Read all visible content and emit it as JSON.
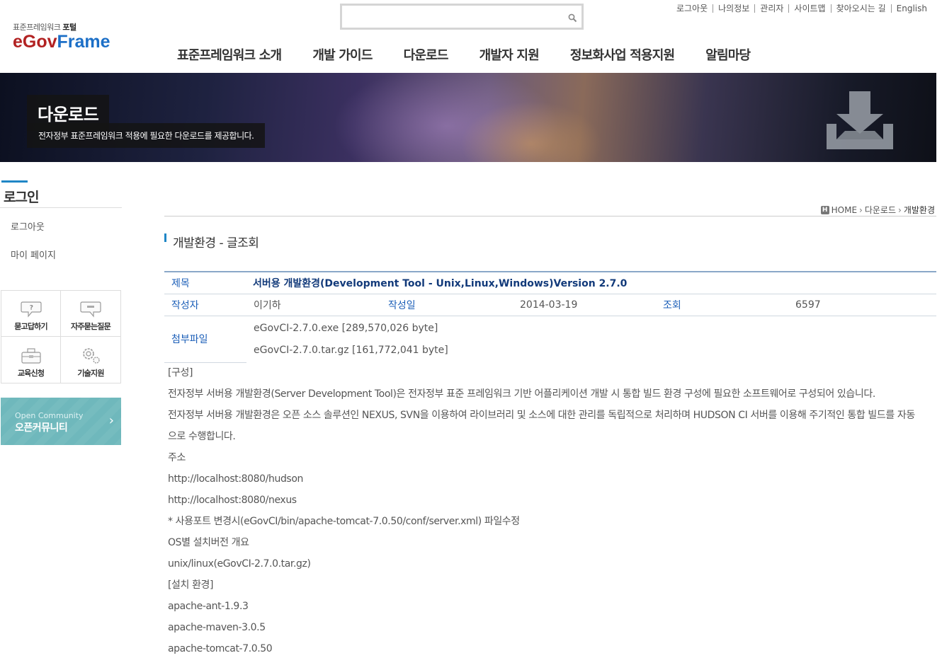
{
  "header": {
    "logo_sub_prefix": "표준프레임워크",
    "logo_sub_bold": "포털",
    "logo_main_egov": "eGov",
    "logo_main_frame": "Frame",
    "search_placeholder": "",
    "util_links": [
      "로그아웃",
      "나의정보",
      "관리자",
      "사이트맵",
      "찾아오시는 길",
      "English"
    ],
    "gnb": [
      "표준프레임워크 소개",
      "개발 가이드",
      "다운로드",
      "개발자 지원",
      "정보화사업 적용지원",
      "알림마당"
    ]
  },
  "banner": {
    "title": "다운로드",
    "description": "전자정부 표준프레임워크 적용에 필요한 다운로드를 제공합니다."
  },
  "sidebar": {
    "title": "로그인",
    "items": [
      "로그아웃",
      "마이 페이지"
    ],
    "quick_links": [
      "묻고답하기",
      "자주묻는질문",
      "교육신청",
      "기술지원"
    ],
    "community_en": "Open Community",
    "community_ko": "오픈커뮤니티"
  },
  "breadcrumb": [
    "HOME",
    "다운로드",
    "개발환경"
  ],
  "page_heading": "개발환경 - 글조회",
  "post": {
    "label_title": "제목",
    "title": "서버용 개발환경(Development Tool - Unix,Linux,Windows)Version 2.7.0",
    "label_author": "작성자",
    "author": "이기하",
    "label_date": "작성일",
    "date": "2014-03-19",
    "label_views": "조회",
    "views": "6597",
    "label_attach": "첨부파일",
    "attachments": [
      "eGovCI-2.7.0.exe [289,570,026 byte]",
      "eGovCI-2.7.0.tar.gz [161,772,041 byte]"
    ]
  },
  "body_lines": [
    "[구성]",
    "전자정부 서버용 개발환경(Server Development Tool)은 전자정부 표준 프레임워크 기반 어플리케이션 개발 시 통합 빌드 환경 구성에 필요한 소프트웨어로 구성되어 있습니다.",
    "전자정부 서버용 개발환경은 오픈 소스 솔루션인 NEXUS, SVN을 이용하여 라이브러리 및 소스에 대한 관리를 독립적으로 처리하며 HUDSON CI 서버를 이용해 주기적인 통합 빌드를 자동",
    "으로 수행합니다.",
    "주소",
    "http://localhost:8080/hudson",
    "http://localhost:8080/nexus",
    "* 사용포트 변경시(eGovCI/bin/apache-tomcat-7.0.50/conf/server.xml) 파일수정",
    "OS별 설치버전 개요",
    "unix/linux(eGovCI-2.7.0.tar.gz)",
    "[설치 환경]",
    "apache-ant-1.9.3",
    "apache-maven-3.0.5",
    "apache-tomcat-7.0.50"
  ]
}
